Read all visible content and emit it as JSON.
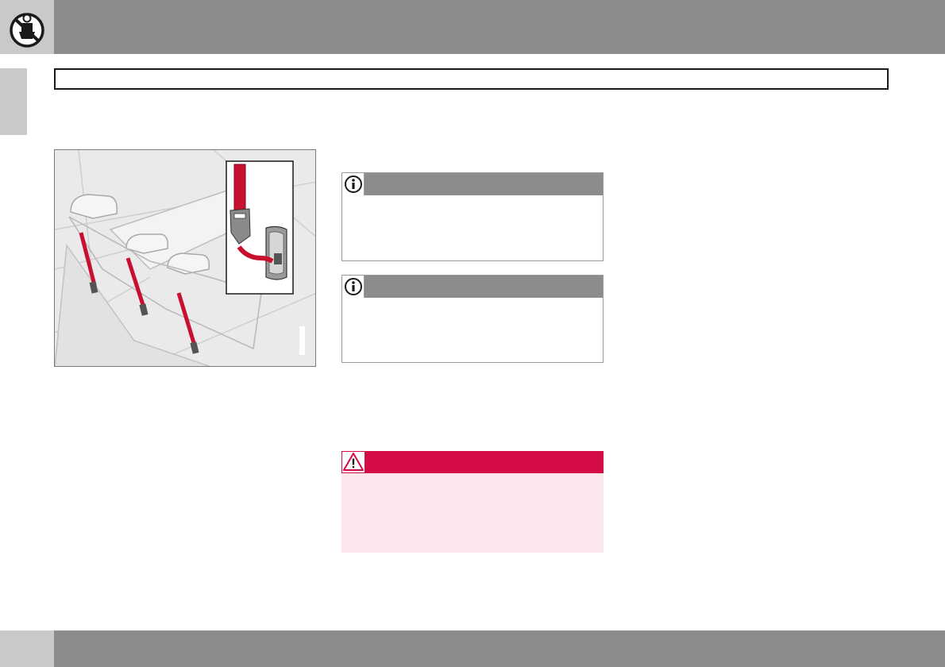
{
  "icons": {
    "header": "child-seat-prohibited-icon",
    "note": "info-icon",
    "warning": "warning-triangle-icon"
  },
  "colors": {
    "header_band": "#8c8c8e",
    "side_tab": "#c9c9cb",
    "warning_accent": "#d50d46",
    "warning_background": "#fbe6ec",
    "strap": "#c8102e"
  },
  "figure": {
    "subject": "rear-seat-tether-straps-illustration"
  }
}
